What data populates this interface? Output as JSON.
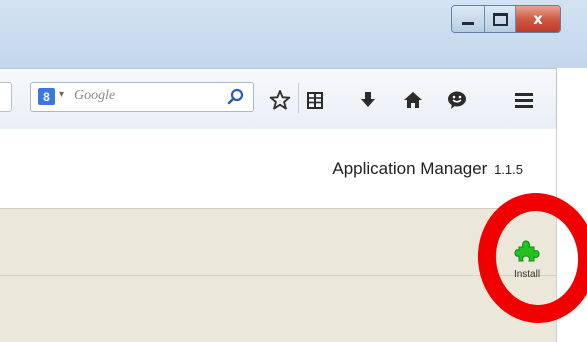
{
  "window": {
    "controls": {
      "minimize_icon": "minimize-icon",
      "maximize_icon": "maximize-icon",
      "close_label": "x"
    },
    "close_color": "#c0392b"
  },
  "toolbar": {
    "search": {
      "engine_badge": "8",
      "placeholder": "Google"
    },
    "icons": [
      "search-magnifier-icon",
      "bookmark-star-icon",
      "reading-list-icon",
      "download-arrow-icon",
      "home-icon",
      "chat-icon",
      "hamburger-menu-icon"
    ]
  },
  "page": {
    "app_title": "Application Manager",
    "app_version": "1.1.5",
    "install_label": "Install",
    "band_color": "#ece8d9",
    "puzzle_color": "#22c21f",
    "highlight_color": "#f00000"
  }
}
